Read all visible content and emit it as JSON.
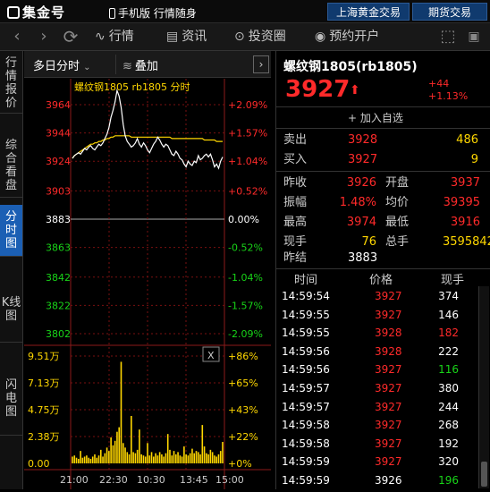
{
  "app": {
    "logo": "集金号",
    "mobile": "手机版",
    "slogan": "行情随身",
    "links": [
      "上海黄金交易",
      "期货交易"
    ]
  },
  "nav": {
    "items": [
      {
        "label": "行情",
        "icon": "chart-icon"
      },
      {
        "label": "资讯",
        "icon": "news-icon"
      },
      {
        "label": "投资圈",
        "icon": "circle-icon"
      },
      {
        "label": "预约开户",
        "icon": "appointment-icon"
      }
    ]
  },
  "sidebar": {
    "tabs": [
      "行情报价",
      "综合看盘",
      "分时图",
      "K线图",
      "闪电图"
    ],
    "active": 2
  },
  "chart_header": {
    "period": "多日分时",
    "overlay": "叠加"
  },
  "chart": {
    "title": "螺纹钢1805 rb1805 分时",
    "close_label": "X"
  },
  "chart_data": {
    "type": "line",
    "title": "螺纹钢1805 rb1805 分时",
    "reference": 3883,
    "price_ticks": [
      3964,
      3944,
      3924,
      3903,
      3883,
      3863,
      3842,
      3822,
      3802
    ],
    "pct_ticks": [
      "+2.09%",
      "+1.57%",
      "+1.04%",
      "+0.52%",
      "0.00%",
      "-0.52%",
      "-1.04%",
      "-1.57%",
      "-2.09%"
    ],
    "x_ticks": [
      "21:00",
      "22:30",
      "10:30",
      "13:45",
      "15:00"
    ],
    "price": [
      3926,
      3928,
      3929,
      3930,
      3929,
      3931,
      3933,
      3932,
      3934,
      3935,
      3933,
      3932,
      3934,
      3936,
      3935,
      3937,
      3940,
      3943,
      3948,
      3955,
      3960,
      3966,
      3974,
      3970,
      3962,
      3950,
      3942,
      3938,
      3936,
      3934,
      3935,
      3937,
      3940,
      3936,
      3934,
      3937,
      3935,
      3932,
      3930,
      3933,
      3936,
      3938,
      3941,
      3939,
      3936,
      3934,
      3936,
      3935,
      3932,
      3929,
      3928,
      3931,
      3929,
      3926,
      3925,
      3922,
      3920,
      3924,
      3922,
      3921,
      3924,
      3923,
      3928,
      3925,
      3926,
      3928,
      3929,
      3927,
      3929,
      3925,
      3920,
      3922,
      3919,
      3924,
      3927
    ],
    "avg": [
      3926,
      3928,
      3929,
      3930,
      3931,
      3932,
      3933,
      3934,
      3935,
      3936,
      3936,
      3937,
      3937,
      3938,
      3938,
      3939,
      3939,
      3940,
      3940,
      3941,
      3941,
      3942,
      3942,
      3942,
      3942,
      3942,
      3942,
      3942,
      3942,
      3941,
      3941,
      3941,
      3941,
      3941,
      3941,
      3941,
      3941,
      3941,
      3941,
      3941,
      3941,
      3941,
      3941,
      3941,
      3941,
      3941,
      3941,
      3941,
      3941,
      3940,
      3940,
      3940,
      3940,
      3940,
      3940,
      3940,
      3940,
      3940,
      3940,
      3940,
      3940,
      3940,
      3940,
      3940,
      3940,
      3939,
      3939,
      3939,
      3939,
      3939,
      3939,
      3938,
      3938,
      3938,
      3938
    ],
    "volume_ticks": [
      "9.51万",
      "7.13万",
      "4.75万",
      "2.38万",
      "0.00"
    ],
    "volume_pct_ticks": [
      "+86%",
      "+65%",
      "+43%",
      "+22%",
      "+0%"
    ],
    "volume": [
      0.6,
      0.7,
      0.5,
      0.4,
      1.1,
      0.5,
      0.6,
      0.7,
      0.5,
      0.4,
      0.6,
      0.8,
      0.5,
      0.7,
      1.2,
      0.6,
      0.9,
      1.4,
      1.1,
      2.3,
      1.6,
      2.0,
      2.8,
      3.2,
      9.0,
      1.8,
      1.4,
      1.0,
      0.8,
      4.2,
      1.0,
      0.9,
      1.2,
      3.0,
      0.8,
      0.7,
      0.6,
      1.8,
      0.7,
      1.0,
      0.6,
      0.9,
      0.7,
      1.0,
      0.8,
      0.6,
      0.9,
      2.6,
      1.2,
      0.7,
      1.1,
      0.8,
      1.0,
      0.7,
      0.6,
      1.5,
      0.8,
      0.7,
      0.9,
      1.3,
      0.9,
      1.1,
      1.0,
      0.8,
      3.4,
      1.5,
      0.9,
      0.8,
      1.2,
      1.0,
      0.7,
      0.6,
      0.8,
      1.1,
      1.9
    ]
  },
  "quote": {
    "name": "螺纹钢1805(rb1805)",
    "price": "3927",
    "arrow": "⬆",
    "change": "+44",
    "change_pct": "+1.13%",
    "add_fav": "加入自选",
    "sell_label": "卖出",
    "sell_price": "3928",
    "sell_vol": "486",
    "buy_label": "买入",
    "buy_price": "3927",
    "buy_vol": "9",
    "stats": [
      [
        "昨收",
        "3926",
        "开盘",
        "3937"
      ],
      [
        "振幅",
        "1.48%",
        "均价",
        "39395"
      ],
      [
        "最高",
        "3974",
        "最低",
        "3916"
      ],
      [
        "现手",
        "76",
        "总手",
        "3595842"
      ]
    ],
    "settle_label": "昨结",
    "settle_value": "3883"
  },
  "ticks": {
    "headers": [
      "时间",
      "价格",
      "现手"
    ],
    "rows": [
      [
        "14:59:54",
        "3927",
        "374",
        "w"
      ],
      [
        "14:59:55",
        "3927",
        "146",
        "w"
      ],
      [
        "14:59:55",
        "3928",
        "182",
        "r"
      ],
      [
        "14:59:56",
        "3928",
        "222",
        "w"
      ],
      [
        "14:59:56",
        "3927",
        "116",
        "g"
      ],
      [
        "14:59:57",
        "3927",
        "380",
        "w"
      ],
      [
        "14:59:57",
        "3927",
        "244",
        "w"
      ],
      [
        "14:59:58",
        "3927",
        "268",
        "w"
      ],
      [
        "14:59:58",
        "3927",
        "192",
        "w"
      ],
      [
        "14:59:59",
        "3927",
        "320",
        "w"
      ],
      [
        "14:59:59",
        "3926",
        "196",
        "g"
      ]
    ]
  },
  "colors": {
    "up": "#ff2a2a",
    "down": "#18d418",
    "line": "#ffffff",
    "avg": "#ffd700",
    "volume": "#ffd700",
    "accent": "#1b5fb4"
  }
}
